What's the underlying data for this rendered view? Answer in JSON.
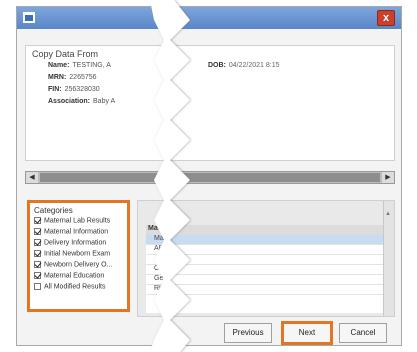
{
  "window": {
    "close_label": "x"
  },
  "copy_from": {
    "title": "Copy Data From",
    "fields": [
      {
        "label": "Name:",
        "value": "TESTING, A"
      },
      {
        "label": "MRN:",
        "value": "2265756"
      },
      {
        "label": "FIN:",
        "value": "256328030"
      },
      {
        "label": "Association:",
        "value": "Baby A"
      }
    ],
    "dob": {
      "label": "DOB:",
      "value": "04/22/2021 8:15"
    }
  },
  "scrollbar": {
    "left_arrow": "◀",
    "right_arrow": "▶"
  },
  "categories": {
    "title": "Categories",
    "items": [
      {
        "label": "Maternal Lab Results",
        "checked": true
      },
      {
        "label": "Maternal Information",
        "checked": true
      },
      {
        "label": "Delivery Information",
        "checked": true
      },
      {
        "label": "Initial Newborn Exam",
        "checked": true
      },
      {
        "label": "Newborn Delivery O...",
        "checked": true
      },
      {
        "label": "Maternal Education",
        "checked": true
      },
      {
        "label": "All Modified Results",
        "checked": false
      }
    ]
  },
  "grid": {
    "header": "Materna",
    "rows": [
      "Mater",
      "AB",
      "",
      "C",
      "Gen",
      "RU"
    ]
  },
  "buttons": {
    "previous": "Previous",
    "next": "Next",
    "cancel": "Cancel"
  },
  "colors": {
    "highlight": "#e47623",
    "titlebar": "#5a86c8"
  }
}
